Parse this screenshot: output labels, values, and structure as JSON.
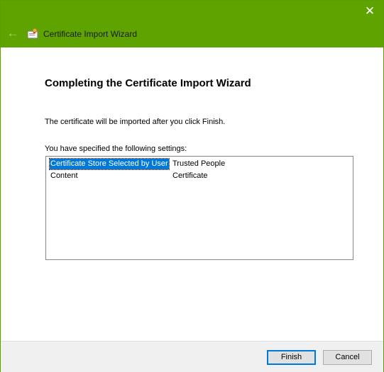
{
  "window": {
    "title": "Certificate Import Wizard",
    "close_glyph": "✕",
    "back_glyph": "←",
    "accent_color": "#5ea300"
  },
  "main": {
    "heading": "Completing the Certificate Import Wizard",
    "info": "The certificate will be imported after you click Finish.",
    "settings_label": "You have specified the following settings:",
    "settings": [
      {
        "key": "Certificate Store Selected by User",
        "value": "Trusted People",
        "selected": true
      },
      {
        "key": "Content",
        "value": "Certificate",
        "selected": false
      }
    ]
  },
  "footer": {
    "finish_label": "Finish",
    "cancel_label": "Cancel"
  }
}
